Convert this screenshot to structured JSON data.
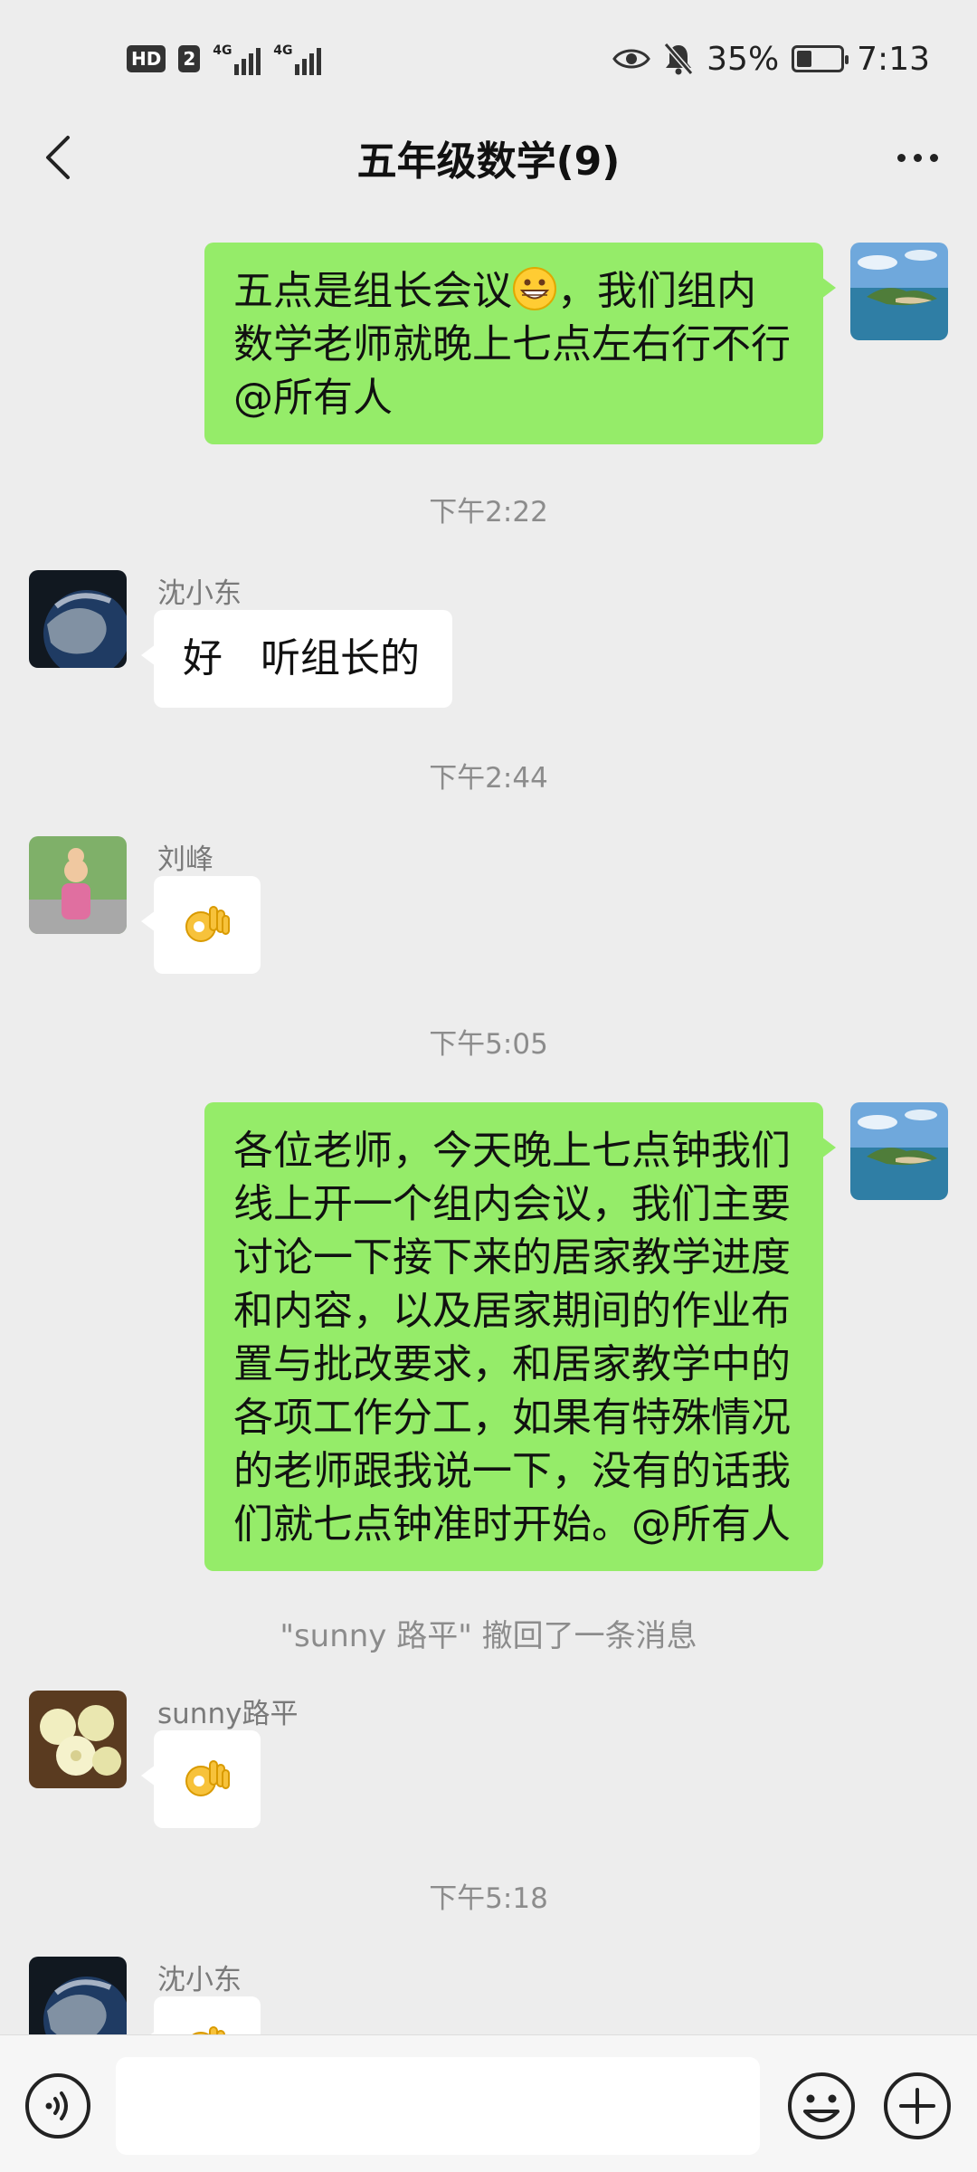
{
  "status": {
    "hd": "HD",
    "sim1": "2",
    "net1": "4G",
    "net2": "4G",
    "battery_pct": "35%",
    "battery_level": 0.35,
    "time": "7:13"
  },
  "header": {
    "title": "五年级数学(9)",
    "back_icon": "chevron-left-icon",
    "more_icon": "more-icon"
  },
  "messages": [
    {
      "side": "right",
      "text_part1": "五点是组长会议",
      "text_part2": "，我们组内数学老师就晚上七点左右行不行@所有人",
      "emoji": "grinning-face"
    },
    {
      "timestamp": "下午2:22"
    },
    {
      "side": "left",
      "sender": "沈小东",
      "text": "好   听组长的"
    },
    {
      "timestamp": "下午2:44"
    },
    {
      "side": "left",
      "sender": "刘峰",
      "emoji": "ok-hand"
    },
    {
      "timestamp": "下午5:05"
    },
    {
      "side": "right",
      "text": "各位老师，今天晚上七点钟我们线上开一个组内会议，我们主要讨论一下接下来的居家教学进度和内容，以及居家期间的作业布置与批改要求，和居家教学中的各项工作分工，如果有特殊情况的老师跟我说一下，没有的话我们就七点钟准时开始。@所有人"
    },
    {
      "system": "\"sunny 路平\" 撤回了一条消息"
    },
    {
      "side": "left",
      "sender": "sunny路平",
      "emoji": "ok-hand"
    },
    {
      "timestamp": "下午5:18"
    },
    {
      "side": "left",
      "sender": "沈小东",
      "emoji": "ok-hand"
    }
  ],
  "inputbar": {
    "voice_icon": "voice-icon",
    "emoji_icon": "smiley-icon",
    "plus_icon": "plus-icon"
  }
}
